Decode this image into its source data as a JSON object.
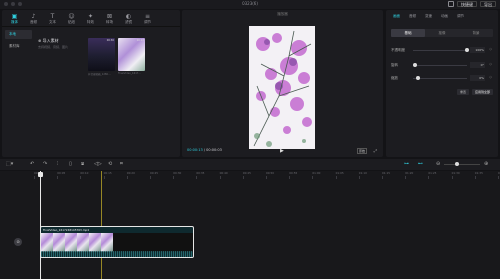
{
  "window": {
    "title": "0323(6)"
  },
  "titlebar": {
    "buttons": [
      "快捷键",
      "导出"
    ]
  },
  "media": {
    "tools": [
      {
        "icon": "media-icon",
        "glyph": "▣",
        "label": "媒体",
        "active": true
      },
      {
        "icon": "audio-icon",
        "glyph": "♪",
        "label": "音频"
      },
      {
        "icon": "text-icon",
        "glyph": "T",
        "label": "文本"
      },
      {
        "icon": "sticker-icon",
        "glyph": "☺",
        "label": "贴纸"
      },
      {
        "icon": "effects-icon",
        "glyph": "✦",
        "label": "特效"
      },
      {
        "icon": "transition-icon",
        "glyph": "⊠",
        "label": "转场"
      },
      {
        "icon": "filter-icon",
        "glyph": "◐",
        "label": "滤镜"
      },
      {
        "icon": "adjust-icon",
        "glyph": "≡",
        "label": "调节"
      }
    ],
    "sidebar": [
      "本地",
      "素材库"
    ],
    "import": {
      "label": "导入素材",
      "hint": "支持视频、音频、图片"
    },
    "clips": [
      {
        "duration": "00:30",
        "caption": "抖音..."
      },
      {
        "duration": "00:03",
        "caption": "FinalVideo..."
      }
    ],
    "captions": [
      "抖音编辑器_1280...",
      "FinalVideo_1617..."
    ]
  },
  "player": {
    "title": "播放器",
    "current_time": "00:00:13",
    "total_time": "00:00:03",
    "ratio": "原始",
    "play_icon": "play-icon"
  },
  "properties": {
    "tabs": [
      {
        "label": "画面",
        "active": true
      },
      {
        "label": "音频"
      },
      {
        "label": "变速"
      },
      {
        "label": "动画"
      },
      {
        "label": "调节"
      }
    ],
    "subtabs": [
      {
        "label": "基础",
        "active": true
      },
      {
        "label": "抠像"
      },
      {
        "label": "背景"
      }
    ],
    "sliders": [
      {
        "label": "不透明度",
        "value": "100%",
        "level": 1.0
      },
      {
        "label": "旋转",
        "value": "0°",
        "level": 0.0
      },
      {
        "label": "缩放",
        "value": "0%",
        "level": 0.05
      }
    ],
    "actions": [
      "重置",
      "应用到全部"
    ]
  },
  "timeline": {
    "ticks": [
      "00:00",
      "00:05",
      "00:10",
      "00:15",
      "00:20",
      "00:25",
      "00:30",
      "00:35",
      "00:40",
      "00:45",
      "00:50",
      "00:55",
      "01:00",
      "01:05",
      "01:10",
      "01:15",
      "01:20",
      "01:25",
      "01:30",
      "01:35",
      "01:40"
    ],
    "clip_name": "FinalVideo_1617248145763.mp4"
  }
}
